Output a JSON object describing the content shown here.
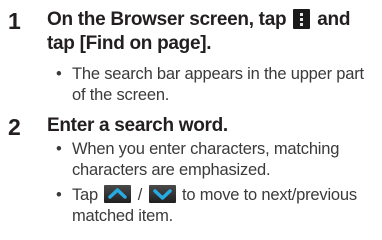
{
  "steps": [
    {
      "number": "1",
      "title_part1": "On the Browser screen, tap",
      "title_part2": "and tap [Find on page].",
      "icons": [
        "menu-icon"
      ],
      "bullets": [
        "The search bar appears in the upper part of the screen."
      ]
    },
    {
      "number": "2",
      "title": "Enter a search word.",
      "icons": [
        "arrow-up-icon",
        "arrow-down-icon"
      ],
      "bullets": {
        "b1": "When you enter characters, matching characters are emphasized.",
        "b2_part1": "Tap",
        "b2_separator": "/",
        "b2_part2": "to move to next/previous matched item."
      }
    }
  ],
  "bullet_glyph": "•",
  "colors": {
    "text": "#231f20",
    "icon_bg": "#1a1a1a",
    "arrow_color": "#27a9e1"
  }
}
